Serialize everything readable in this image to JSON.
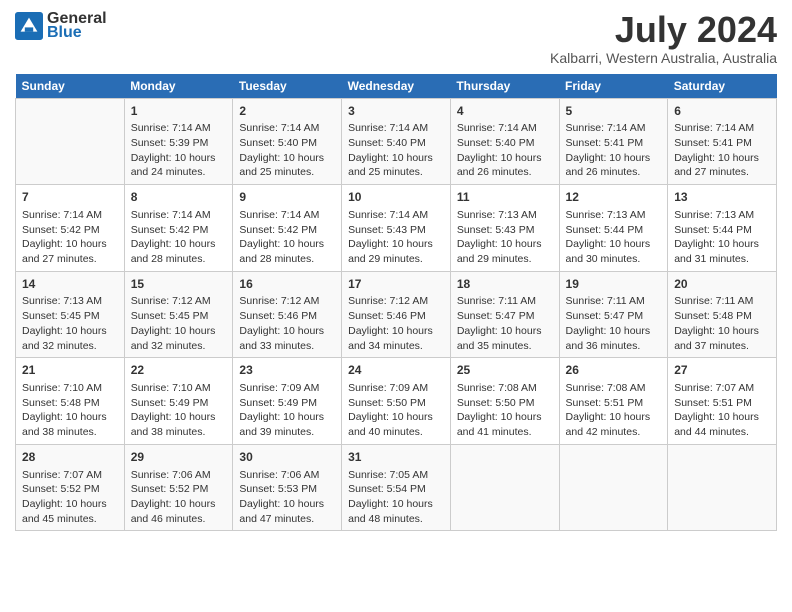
{
  "header": {
    "logo_line1": "General",
    "logo_line2": "Blue",
    "month_year": "July 2024",
    "location": "Kalbarri, Western Australia, Australia"
  },
  "days_of_week": [
    "Sunday",
    "Monday",
    "Tuesday",
    "Wednesday",
    "Thursday",
    "Friday",
    "Saturday"
  ],
  "weeks": [
    [
      {
        "day": "",
        "info": ""
      },
      {
        "day": "1",
        "info": "Sunrise: 7:14 AM\nSunset: 5:39 PM\nDaylight: 10 hours\nand 24 minutes."
      },
      {
        "day": "2",
        "info": "Sunrise: 7:14 AM\nSunset: 5:40 PM\nDaylight: 10 hours\nand 25 minutes."
      },
      {
        "day": "3",
        "info": "Sunrise: 7:14 AM\nSunset: 5:40 PM\nDaylight: 10 hours\nand 25 minutes."
      },
      {
        "day": "4",
        "info": "Sunrise: 7:14 AM\nSunset: 5:40 PM\nDaylight: 10 hours\nand 26 minutes."
      },
      {
        "day": "5",
        "info": "Sunrise: 7:14 AM\nSunset: 5:41 PM\nDaylight: 10 hours\nand 26 minutes."
      },
      {
        "day": "6",
        "info": "Sunrise: 7:14 AM\nSunset: 5:41 PM\nDaylight: 10 hours\nand 27 minutes."
      }
    ],
    [
      {
        "day": "7",
        "info": "Sunrise: 7:14 AM\nSunset: 5:42 PM\nDaylight: 10 hours\nand 27 minutes."
      },
      {
        "day": "8",
        "info": "Sunrise: 7:14 AM\nSunset: 5:42 PM\nDaylight: 10 hours\nand 28 minutes."
      },
      {
        "day": "9",
        "info": "Sunrise: 7:14 AM\nSunset: 5:42 PM\nDaylight: 10 hours\nand 28 minutes."
      },
      {
        "day": "10",
        "info": "Sunrise: 7:14 AM\nSunset: 5:43 PM\nDaylight: 10 hours\nand 29 minutes."
      },
      {
        "day": "11",
        "info": "Sunrise: 7:13 AM\nSunset: 5:43 PM\nDaylight: 10 hours\nand 29 minutes."
      },
      {
        "day": "12",
        "info": "Sunrise: 7:13 AM\nSunset: 5:44 PM\nDaylight: 10 hours\nand 30 minutes."
      },
      {
        "day": "13",
        "info": "Sunrise: 7:13 AM\nSunset: 5:44 PM\nDaylight: 10 hours\nand 31 minutes."
      }
    ],
    [
      {
        "day": "14",
        "info": "Sunrise: 7:13 AM\nSunset: 5:45 PM\nDaylight: 10 hours\nand 32 minutes."
      },
      {
        "day": "15",
        "info": "Sunrise: 7:12 AM\nSunset: 5:45 PM\nDaylight: 10 hours\nand 32 minutes."
      },
      {
        "day": "16",
        "info": "Sunrise: 7:12 AM\nSunset: 5:46 PM\nDaylight: 10 hours\nand 33 minutes."
      },
      {
        "day": "17",
        "info": "Sunrise: 7:12 AM\nSunset: 5:46 PM\nDaylight: 10 hours\nand 34 minutes."
      },
      {
        "day": "18",
        "info": "Sunrise: 7:11 AM\nSunset: 5:47 PM\nDaylight: 10 hours\nand 35 minutes."
      },
      {
        "day": "19",
        "info": "Sunrise: 7:11 AM\nSunset: 5:47 PM\nDaylight: 10 hours\nand 36 minutes."
      },
      {
        "day": "20",
        "info": "Sunrise: 7:11 AM\nSunset: 5:48 PM\nDaylight: 10 hours\nand 37 minutes."
      }
    ],
    [
      {
        "day": "21",
        "info": "Sunrise: 7:10 AM\nSunset: 5:48 PM\nDaylight: 10 hours\nand 38 minutes."
      },
      {
        "day": "22",
        "info": "Sunrise: 7:10 AM\nSunset: 5:49 PM\nDaylight: 10 hours\nand 38 minutes."
      },
      {
        "day": "23",
        "info": "Sunrise: 7:09 AM\nSunset: 5:49 PM\nDaylight: 10 hours\nand 39 minutes."
      },
      {
        "day": "24",
        "info": "Sunrise: 7:09 AM\nSunset: 5:50 PM\nDaylight: 10 hours\nand 40 minutes."
      },
      {
        "day": "25",
        "info": "Sunrise: 7:08 AM\nSunset: 5:50 PM\nDaylight: 10 hours\nand 41 minutes."
      },
      {
        "day": "26",
        "info": "Sunrise: 7:08 AM\nSunset: 5:51 PM\nDaylight: 10 hours\nand 42 minutes."
      },
      {
        "day": "27",
        "info": "Sunrise: 7:07 AM\nSunset: 5:51 PM\nDaylight: 10 hours\nand 44 minutes."
      }
    ],
    [
      {
        "day": "28",
        "info": "Sunrise: 7:07 AM\nSunset: 5:52 PM\nDaylight: 10 hours\nand 45 minutes."
      },
      {
        "day": "29",
        "info": "Sunrise: 7:06 AM\nSunset: 5:52 PM\nDaylight: 10 hours\nand 46 minutes."
      },
      {
        "day": "30",
        "info": "Sunrise: 7:06 AM\nSunset: 5:53 PM\nDaylight: 10 hours\nand 47 minutes."
      },
      {
        "day": "31",
        "info": "Sunrise: 7:05 AM\nSunset: 5:54 PM\nDaylight: 10 hours\nand 48 minutes."
      },
      {
        "day": "",
        "info": ""
      },
      {
        "day": "",
        "info": ""
      },
      {
        "day": "",
        "info": ""
      }
    ]
  ]
}
